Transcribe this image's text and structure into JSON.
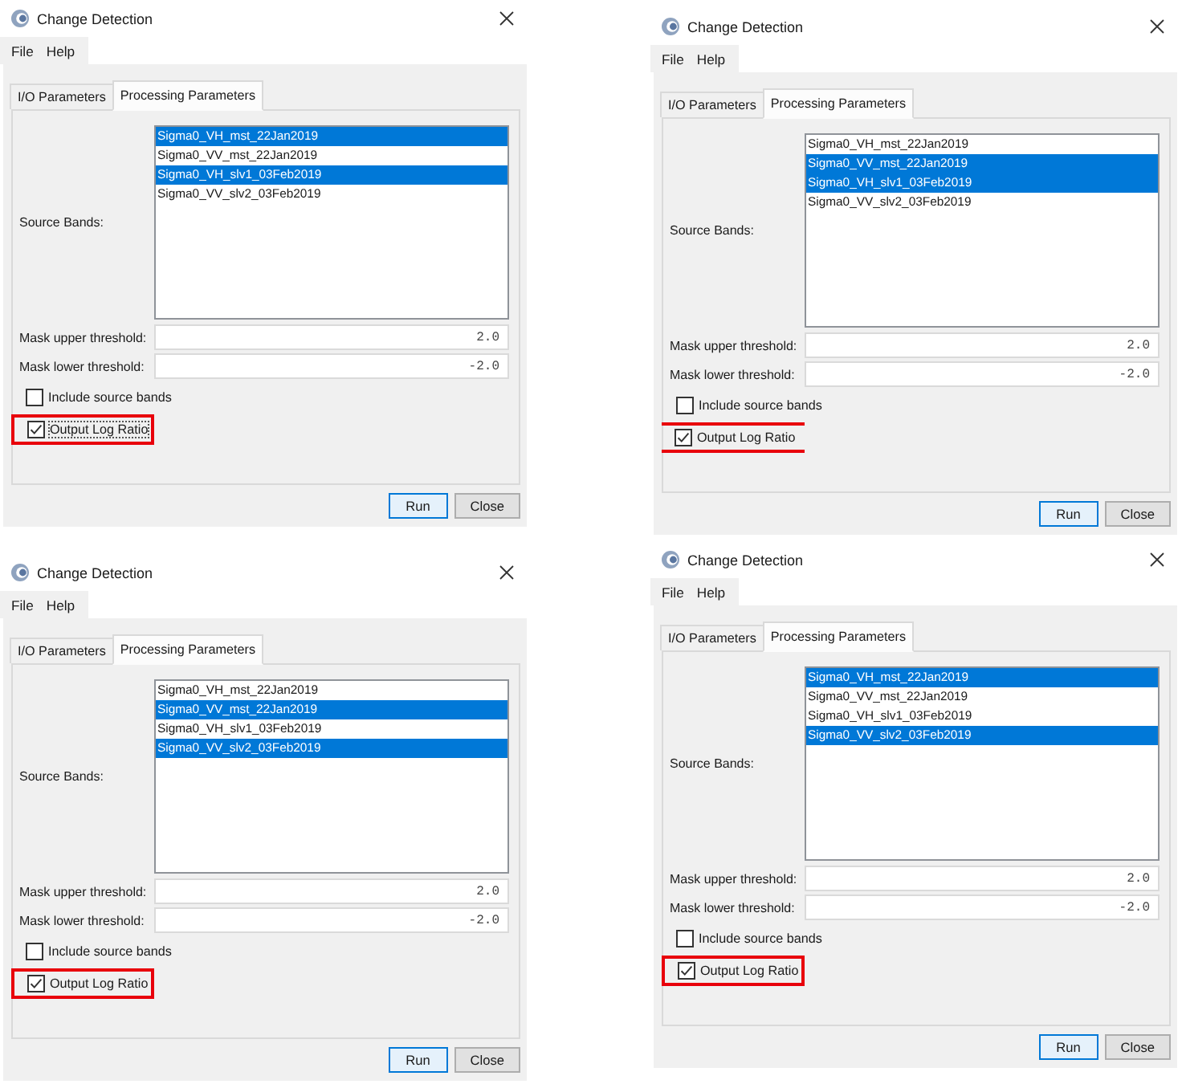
{
  "dialogs": [
    {
      "title": "Change Detection",
      "menu": [
        {
          "label": "File"
        },
        {
          "label": "Help"
        }
      ],
      "tabs": [
        {
          "label": "I/O Parameters",
          "selected": false
        },
        {
          "label": "Processing Parameters",
          "selected": true
        }
      ],
      "source_bands": {
        "label": "Source Bands:",
        "items": [
          {
            "label": "Sigma0_VH_mst_22Jan2019",
            "selected": true
          },
          {
            "label": "Sigma0_VV_mst_22Jan2019",
            "selected": false
          },
          {
            "label": "Sigma0_VH_slv1_03Feb2019",
            "selected": true
          },
          {
            "label": "Sigma0_VV_slv2_03Feb2019",
            "selected": false
          }
        ]
      },
      "thresholds": [
        {
          "label": "Mask upper threshold:",
          "value": "2.0"
        },
        {
          "label": "Mask lower threshold:",
          "value": "-2.0"
        }
      ],
      "checkboxes": [
        {
          "kind": "plain",
          "label": "Include source bands",
          "checked": false,
          "focused": false
        },
        {
          "kind": "boxed",
          "label": "Output Log Ratio",
          "checked": true,
          "focused": true
        }
      ],
      "buttons": [
        {
          "label": "Run",
          "default": true
        },
        {
          "label": "Close",
          "default": false
        }
      ]
    },
    {
      "title": "Change Detection",
      "menu": [
        {
          "label": "File"
        },
        {
          "label": "Help"
        }
      ],
      "tabs": [
        {
          "label": "I/O Parameters",
          "selected": false
        },
        {
          "label": "Processing Parameters",
          "selected": true
        }
      ],
      "source_bands": {
        "label": "Source Bands:",
        "items": [
          {
            "label": "Sigma0_VH_mst_22Jan2019",
            "selected": false
          },
          {
            "label": "Sigma0_VV_mst_22Jan2019",
            "selected": true
          },
          {
            "label": "Sigma0_VH_slv1_03Feb2019",
            "selected": true
          },
          {
            "label": "Sigma0_VV_slv2_03Feb2019",
            "selected": false
          }
        ]
      },
      "thresholds": [
        {
          "label": "Mask upper threshold:",
          "value": "2.0"
        },
        {
          "label": "Mask lower threshold:",
          "value": "-2.0"
        }
      ],
      "checkboxes": [
        {
          "kind": "plain",
          "label": "Include source bands",
          "checked": false,
          "focused": false
        },
        {
          "kind": "ruled",
          "label": "Output Log Ratio",
          "checked": true,
          "focused": false
        }
      ],
      "buttons": [
        {
          "label": "Run",
          "default": true
        },
        {
          "label": "Close",
          "default": false
        }
      ]
    },
    {
      "title": "Change Detection",
      "menu": [
        {
          "label": "File"
        },
        {
          "label": "Help"
        }
      ],
      "tabs": [
        {
          "label": "I/O Parameters",
          "selected": false
        },
        {
          "label": "Processing Parameters",
          "selected": true
        }
      ],
      "source_bands": {
        "label": "Source Bands:",
        "items": [
          {
            "label": "Sigma0_VH_mst_22Jan2019",
            "selected": false
          },
          {
            "label": "Sigma0_VV_mst_22Jan2019",
            "selected": true
          },
          {
            "label": "Sigma0_VH_slv1_03Feb2019",
            "selected": false
          },
          {
            "label": "Sigma0_VV_slv2_03Feb2019",
            "selected": true
          }
        ]
      },
      "thresholds": [
        {
          "label": "Mask upper threshold:",
          "value": "2.0"
        },
        {
          "label": "Mask lower threshold:",
          "value": "-2.0"
        }
      ],
      "checkboxes": [
        {
          "kind": "plain",
          "label": "Include source bands",
          "checked": false,
          "focused": false
        },
        {
          "kind": "boxed",
          "label": "Output Log Ratio",
          "checked": true,
          "focused": false
        }
      ],
      "buttons": [
        {
          "label": "Run",
          "default": true
        },
        {
          "label": "Close",
          "default": false
        }
      ]
    },
    {
      "title": "Change Detection",
      "menu": [
        {
          "label": "File"
        },
        {
          "label": "Help"
        }
      ],
      "tabs": [
        {
          "label": "I/O Parameters",
          "selected": false
        },
        {
          "label": "Processing Parameters",
          "selected": true
        }
      ],
      "source_bands": {
        "label": "Source Bands:",
        "items": [
          {
            "label": "Sigma0_VH_mst_22Jan2019",
            "selected": true
          },
          {
            "label": "Sigma0_VV_mst_22Jan2019",
            "selected": false
          },
          {
            "label": "Sigma0_VH_slv1_03Feb2019",
            "selected": false
          },
          {
            "label": "Sigma0_VV_slv2_03Feb2019",
            "selected": true
          }
        ]
      },
      "thresholds": [
        {
          "label": "Mask upper threshold:",
          "value": "2.0"
        },
        {
          "label": "Mask lower threshold:",
          "value": "-2.0"
        }
      ],
      "checkboxes": [
        {
          "kind": "plain",
          "label": "Include source bands",
          "checked": false,
          "focused": false
        },
        {
          "kind": "boxed",
          "label": "Output Log Ratio",
          "checked": true,
          "focused": false
        }
      ],
      "buttons": [
        {
          "label": "Run",
          "default": true
        },
        {
          "label": "Close",
          "default": false
        }
      ]
    }
  ]
}
